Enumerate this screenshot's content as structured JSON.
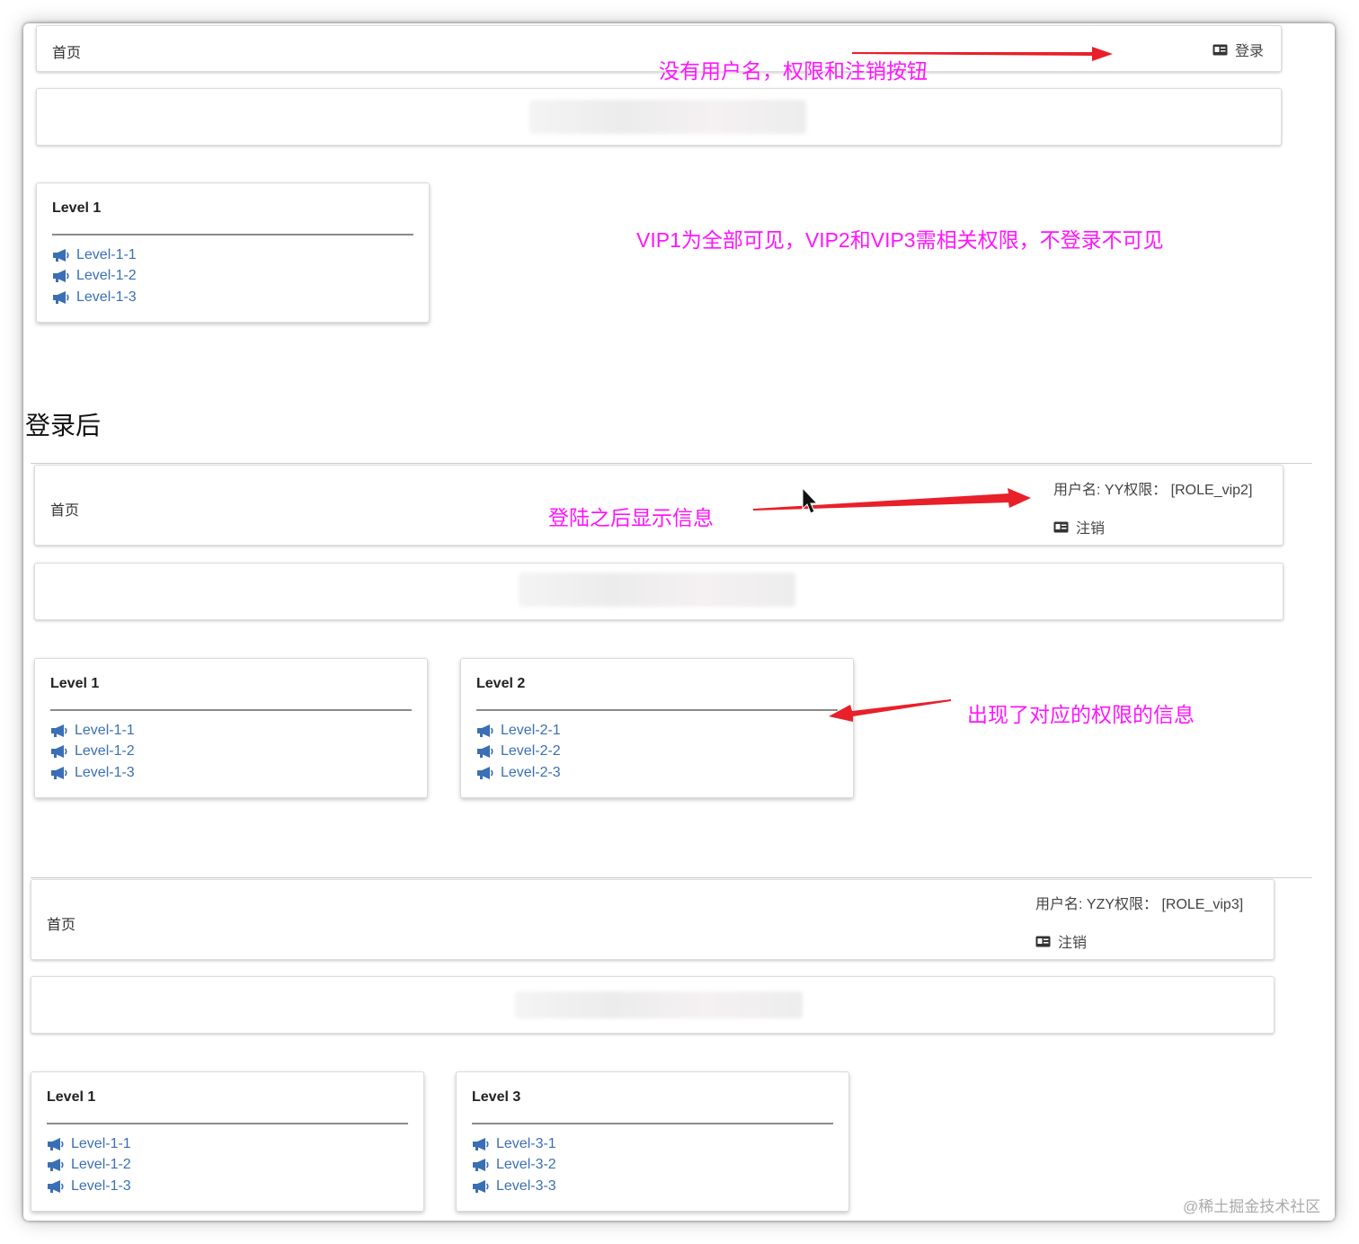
{
  "panel1": {
    "nav": {
      "home": "首页",
      "login_label": "登录"
    },
    "cards": [
      {
        "title": "Level 1",
        "items": [
          "Level-1-1",
          "Level-1-2",
          "Level-1-3"
        ]
      }
    ]
  },
  "panel2": {
    "nav": {
      "home": "首页",
      "user_info": "用户名:  YY权限：  [ROLE_vip2]",
      "logout_label": "注销"
    },
    "cards": [
      {
        "title": "Level 1",
        "items": [
          "Level-1-1",
          "Level-1-2",
          "Level-1-3"
        ]
      },
      {
        "title": "Level 2",
        "items": [
          "Level-2-1",
          "Level-2-2",
          "Level-2-3"
        ]
      }
    ]
  },
  "panel3": {
    "nav": {
      "home": "首页",
      "user_info": "用户名:  YZY权限：  [ROLE_vip3]",
      "logout_label": "注销"
    },
    "cards": [
      {
        "title": "Level 1",
        "items": [
          "Level-1-1",
          "Level-1-2",
          "Level-1-3"
        ]
      },
      {
        "title": "Level 3",
        "items": [
          "Level-3-1",
          "Level-3-2",
          "Level-3-3"
        ]
      }
    ]
  },
  "annotations": {
    "no_user": "没有用户名，权限和注销按钮",
    "vip_rule": "VIP1为全部可见，VIP2和VIP3需相关权限，不登录不可见",
    "after_login_heading": "登录后",
    "show_info": "登陆之后显示信息",
    "level_info": "出现了对应的权限的信息"
  },
  "watermark": "@稀土掘金技术社区",
  "colors": {
    "annotation": "#ff14ff",
    "arrow": "#e8202a",
    "link": "#3a6fb5"
  },
  "icons": {
    "card_item": "bullhorn-icon",
    "login": "id-card-icon",
    "logout": "id-card-icon"
  }
}
